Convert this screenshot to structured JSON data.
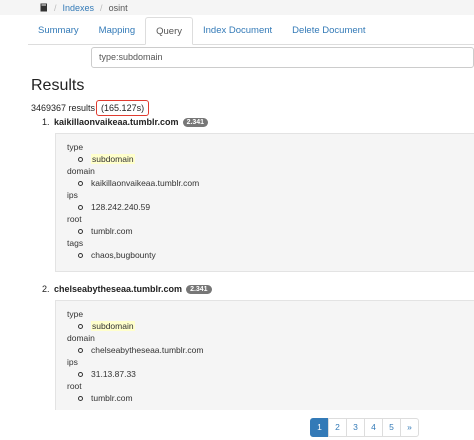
{
  "breadcrumb": {
    "items": [
      "Indexes",
      "osint"
    ]
  },
  "tabs": [
    "Summary",
    "Mapping",
    "Query",
    "Index Document",
    "Delete Document"
  ],
  "active_tab": "Query",
  "query": {
    "value": "type:subdomain"
  },
  "results": {
    "title": "Results",
    "count": "3469367 results",
    "time": "(165.127s)",
    "items": [
      {
        "number": "1.",
        "host": "kaikillaonvaikeaa.tumblr.com",
        "score": "2.341",
        "fields": {
          "type_label": "type",
          "type_value": "subdomain",
          "domain_label": "domain",
          "domain_value": "kaikillaonvaikeaa.tumblr.com",
          "ips_label": "ips",
          "ips_value": "128.242.240.59",
          "root_label": "root",
          "root_value": "tumblr.com",
          "tags_label": "tags",
          "tags_value": "chaos,bugbounty"
        }
      },
      {
        "number": "2.",
        "host": "chelseabytheseaa.tumblr.com",
        "score": "2.341",
        "fields": {
          "type_label": "type",
          "type_value": "subdomain",
          "domain_label": "domain",
          "domain_value": "chelseabytheseaa.tumblr.com",
          "ips_label": "ips",
          "ips_value": "31.13.87.33",
          "root_label": "root",
          "root_value": "tumblr.com"
        }
      }
    ]
  },
  "pagination": [
    "1",
    "2",
    "3",
    "4",
    "5",
    "»"
  ],
  "colors": {
    "link": "#337ab7",
    "highlight_box": "#e03b2f",
    "badge": "#777777",
    "match_highlight": "#ffffcc"
  }
}
